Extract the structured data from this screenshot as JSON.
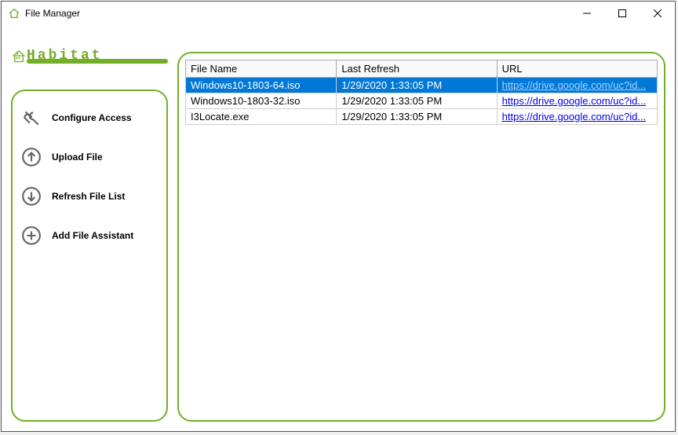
{
  "window": {
    "title": "File Manager"
  },
  "logo": {
    "text": "Habitat"
  },
  "sidebar": {
    "items": [
      {
        "label": "Configure Access"
      },
      {
        "label": "Upload File"
      },
      {
        "label": "Refresh File List"
      },
      {
        "label": "Add File Assistant"
      }
    ]
  },
  "table": {
    "columns": [
      "File Name",
      "Last Refresh",
      "URL"
    ],
    "rows": [
      {
        "name": "Windows10-1803-64.iso",
        "refresh": "1/29/2020 1:33:05 PM",
        "url": "https://drive.google.com/uc?id...",
        "selected": true
      },
      {
        "name": "Windows10-1803-32.iso",
        "refresh": "1/29/2020 1:33:05 PM",
        "url": "https://drive.google.com/uc?id...",
        "selected": false
      },
      {
        "name": "I3Locate.exe",
        "refresh": "1/29/2020 1:33:05 PM",
        "url": "https://drive.google.com/uc?id...",
        "selected": false
      }
    ]
  }
}
